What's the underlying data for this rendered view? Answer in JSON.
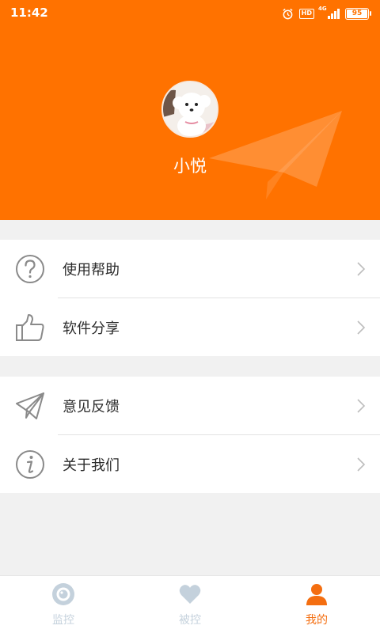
{
  "status_bar": {
    "time": "11:42",
    "hd_label": "HD",
    "network_label": "4G",
    "battery": "95",
    "icons": [
      "alarm-icon",
      "hd-icon",
      "signal-icon",
      "battery-icon"
    ]
  },
  "profile": {
    "username": "小悦",
    "avatar": "avatar-photo-dog"
  },
  "menu": {
    "group1": [
      {
        "label": "使用帮助",
        "icon": "help-circle-icon"
      },
      {
        "label": "软件分享",
        "icon": "thumbs-up-icon"
      }
    ],
    "group2": [
      {
        "label": "意见反馈",
        "icon": "paper-plane-icon"
      },
      {
        "label": "关于我们",
        "icon": "info-circle-icon"
      }
    ]
  },
  "tabbar": {
    "tabs": [
      {
        "label": "监控",
        "icon": "monitor-camera-icon",
        "active": false
      },
      {
        "label": "被控",
        "icon": "heart-icon",
        "active": false
      },
      {
        "label": "我的",
        "icon": "person-icon",
        "active": true
      }
    ]
  },
  "colors": {
    "accent": "#ff7200",
    "tab_inactive": "#c4d1dc",
    "tab_active": "#f46e10",
    "menu_icon": "#8a8a8a",
    "background": "#f1f1f1"
  }
}
